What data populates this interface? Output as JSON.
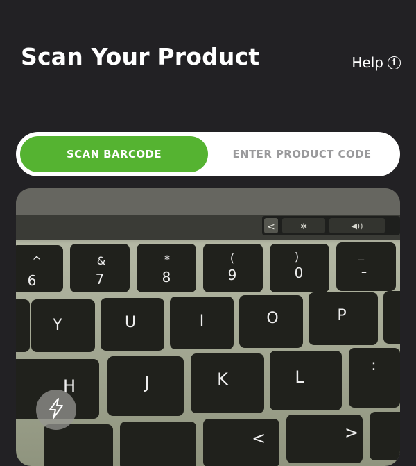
{
  "header": {
    "title": "Scan Your Product",
    "help_label": "Help",
    "help_icon": "info-icon"
  },
  "tabs": [
    {
      "label": "SCAN BARCODE",
      "active": true
    },
    {
      "label": "ENTER PRODUCT CODE",
      "active": false
    }
  ],
  "camera": {
    "touchbar_keys": [
      "<",
      "✲",
      "◀))"
    ],
    "number_row": [
      {
        "shift": "^",
        "main": "6"
      },
      {
        "shift": "&",
        "main": "7"
      },
      {
        "shift": "*",
        "main": "8"
      },
      {
        "shift": "(",
        "main": "9"
      },
      {
        "shift": ")",
        "main": "0"
      },
      {
        "shift": "_",
        "main": "–"
      }
    ],
    "row2": [
      "Y",
      "U",
      "I",
      "O",
      "P"
    ],
    "row3": [
      "H",
      "J",
      "K",
      "L"
    ],
    "row3_extra": ":",
    "row4": [
      "<",
      ">"
    ],
    "flash_icon": "lightning-icon"
  },
  "colors": {
    "background": "#222124",
    "accent": "#55b331",
    "inactive_tab_text": "#9a9a9c"
  }
}
